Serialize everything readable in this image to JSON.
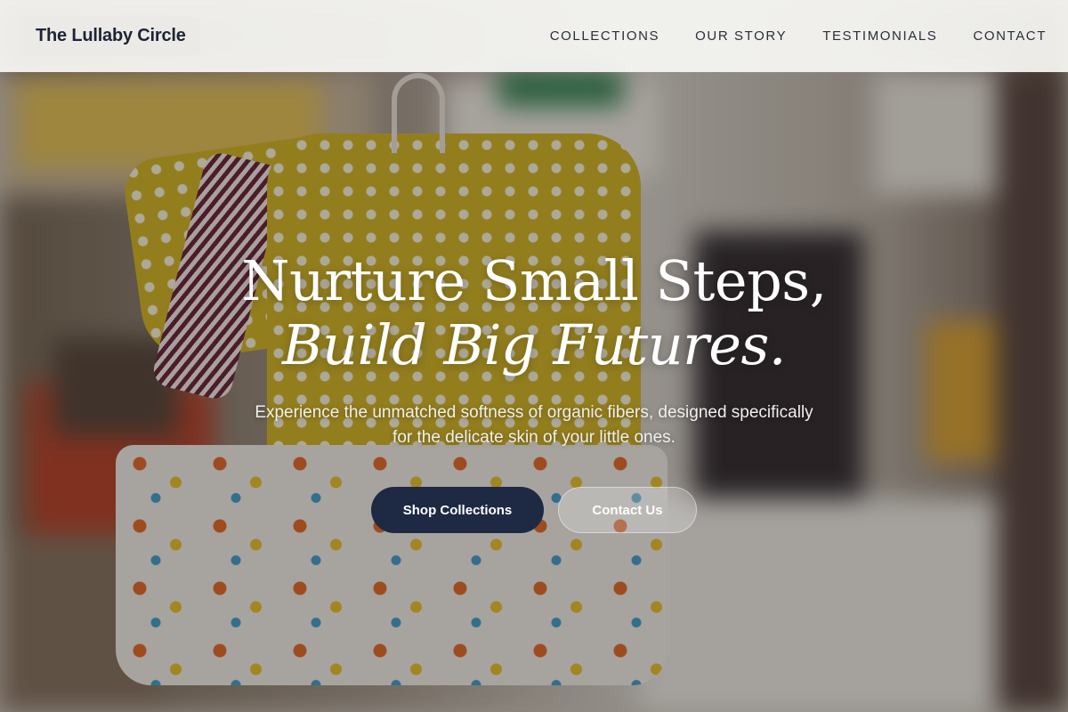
{
  "brand": {
    "name": "The Lullaby Circle"
  },
  "nav": {
    "items": [
      {
        "label": "COLLECTIONS"
      },
      {
        "label": "OUR STORY"
      },
      {
        "label": "TESTIMONIALS"
      },
      {
        "label": "CONTACT"
      }
    ]
  },
  "hero": {
    "headline_line1": "Nurture Small Steps,",
    "headline_line2": "Build Big Futures.",
    "subtitle": "Experience the unmatched softness of organic fibers, designed specifically for the delicate skin of your little ones.",
    "primary_cta": "Shop Collections",
    "secondary_cta": "Contact Us"
  },
  "colors": {
    "header_bg": "#f8f7f4",
    "brand_text": "#1d2436",
    "primary_button": "#1e2a44",
    "hero_text": "#ffffff"
  }
}
